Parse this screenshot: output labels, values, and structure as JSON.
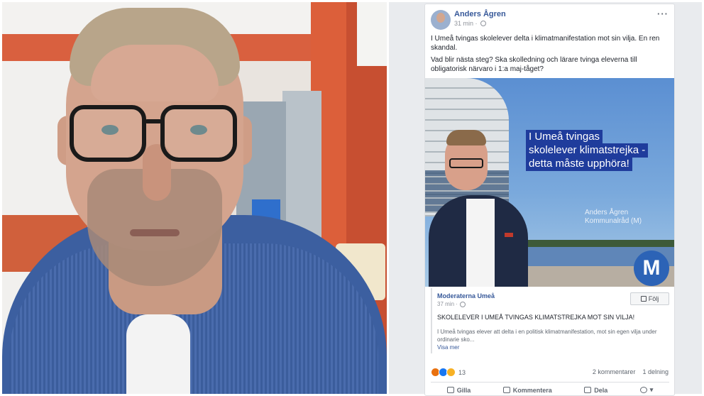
{
  "post": {
    "author": "Anders Ågren",
    "time": "31 min ·",
    "more_icon": "···",
    "paragraph1": "I Umeå tvingas skolelever delta i klimatmanifestation mot sin vilja. En ren skandal.",
    "paragraph2": "Vad blir nästa steg? Ska skolledning och lärare tvinga eleverna till obligatorisk närvaro i 1:a maj-tåget?"
  },
  "banner": {
    "headline": [
      "I Umeå tvingas",
      "skolelever klimatstrejka -",
      "detta måste upphöra!"
    ],
    "signature_name": "Anders Ågren",
    "signature_role": "Kommunalråd (M)",
    "logo_glyph": "M"
  },
  "shared": {
    "page_name": "Moderaterna Umeå",
    "time": "37 min ·",
    "follow_label": "Följ",
    "title": "SKOLELEVER I UMEÅ TVINGAS KLIMATSTREJKA MOT SIN VILJA!",
    "body": "I Umeå tvingas elever att delta i en politisk klimatmanifestation, mot sin egen vilja under ordinarie sko...",
    "more_label": "Visa mer"
  },
  "stats": {
    "reaction_count": "13",
    "comments": "2 kommentarer",
    "shares": "1 delning"
  },
  "actions": {
    "like": "Gilla",
    "comment": "Kommentera",
    "share": "Dela"
  },
  "colors": {
    "link_blue": "#365899",
    "banner_highlight": "#1f3c9c",
    "page_bg": "#e9ebee"
  }
}
